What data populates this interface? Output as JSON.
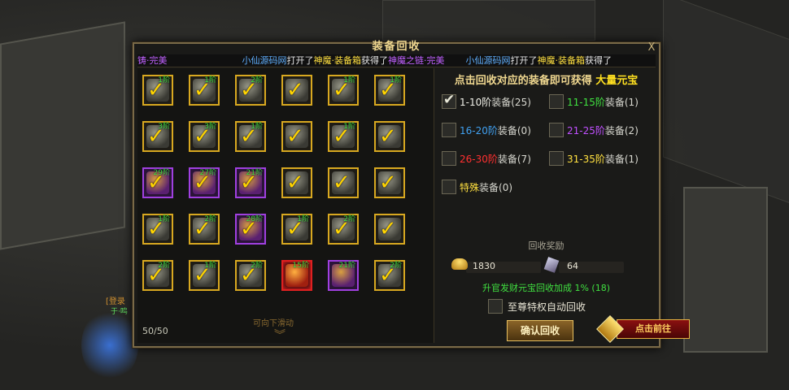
{
  "panel": {
    "title": "装备回收",
    "close": "X"
  },
  "ticker": [
    {
      "text": "铸·完美",
      "color": "purple"
    },
    {
      "text": "小仙源码网",
      "color": "blue"
    },
    {
      "text": "打开了",
      "color": "white"
    },
    {
      "text": "神魔·装备箱",
      "color": "yellow"
    },
    {
      "text": "获得了",
      "color": "white"
    },
    {
      "text": "神魔之链·完美",
      "color": "purple"
    },
    {
      "text": "小仙源码网",
      "color": "blue"
    },
    {
      "text": "打开了",
      "color": "white"
    },
    {
      "text": "神魔·装备箱",
      "color": "yellow"
    },
    {
      "text": "获得了",
      "color": "white"
    }
  ],
  "grid": {
    "rows": [
      [
        {
          "tier": "1阶",
          "rarity": "gold"
        },
        {
          "tier": "1阶",
          "rarity": "gold"
        },
        {
          "tier": "2阶",
          "rarity": "gold"
        },
        {
          "tier": "",
          "rarity": "gold"
        },
        {
          "tier": "1阶",
          "rarity": "gold"
        },
        {
          "tier": "1阶",
          "rarity": "gold"
        }
      ],
      [
        {
          "tier": "3阶",
          "rarity": "gold"
        },
        {
          "tier": "3阶",
          "rarity": "gold"
        },
        {
          "tier": "1阶",
          "rarity": "gold"
        },
        {
          "tier": "",
          "rarity": "gold"
        },
        {
          "tier": "1阶",
          "rarity": "gold"
        },
        {
          "tier": "",
          "rarity": "gold"
        }
      ],
      [
        {
          "tier": "29阶",
          "rarity": "purple"
        },
        {
          "tier": "27阶",
          "rarity": "purple"
        },
        {
          "tier": "21阶",
          "rarity": "purple"
        },
        {
          "tier": "",
          "rarity": "gold"
        },
        {
          "tier": "",
          "rarity": "gold"
        },
        {
          "tier": "",
          "rarity": "gold"
        }
      ],
      [
        {
          "tier": "1阶",
          "rarity": "gold"
        },
        {
          "tier": "2阶",
          "rarity": "gold"
        },
        {
          "tier": "28阶",
          "rarity": "purple"
        },
        {
          "tier": "1阶",
          "rarity": "gold"
        },
        {
          "tier": "2阶",
          "rarity": "gold"
        },
        {
          "tier": "",
          "rarity": "gold"
        }
      ],
      [
        {
          "tier": "2阶",
          "rarity": "gold"
        },
        {
          "tier": "1阶",
          "rarity": "gold"
        },
        {
          "tier": "2阶",
          "rarity": "gold"
        },
        {
          "tier": "15阶",
          "rarity": "red",
          "checked": false
        },
        {
          "tier": "21阶",
          "rarity": "purple",
          "checked": false
        },
        {
          "tier": "2阶",
          "rarity": "gold"
        }
      ]
    ],
    "count": "50/50",
    "scroll_hint": "可向下滑动"
  },
  "right": {
    "headline_a": "点击回收对应的装备即可获得",
    "headline_b": "大量元宝",
    "options": [
      {
        "range": "1-10阶",
        "suffix": "装备(25)",
        "color": "white",
        "checked": true
      },
      {
        "range": "11-15阶",
        "suffix": "装备(1)",
        "color": "green",
        "checked": false
      },
      {
        "range": "16-20阶",
        "suffix": "装备(0)",
        "color": "blue",
        "checked": false
      },
      {
        "range": "21-25阶",
        "suffix": "装备(2)",
        "color": "purple",
        "checked": false
      },
      {
        "range": "26-30阶",
        "suffix": "装备(7)",
        "color": "red",
        "checked": false
      },
      {
        "range": "31-35阶",
        "suffix": "装备(1)",
        "color": "yellow",
        "checked": false
      },
      {
        "range": "特殊",
        "suffix": "装备(0)",
        "color": "yellow",
        "checked": false
      }
    ],
    "reward_title": "回收奖励",
    "ingot_value": "1830",
    "stone_value": "64",
    "bonus": "升官发财元宝回收加成 1% (18)",
    "auto_label": "至尊特权自动回收",
    "confirm": "确认回收"
  },
  "goto": "点击前往",
  "side": {
    "label": "[登录",
    "label2": "于·鸣"
  }
}
